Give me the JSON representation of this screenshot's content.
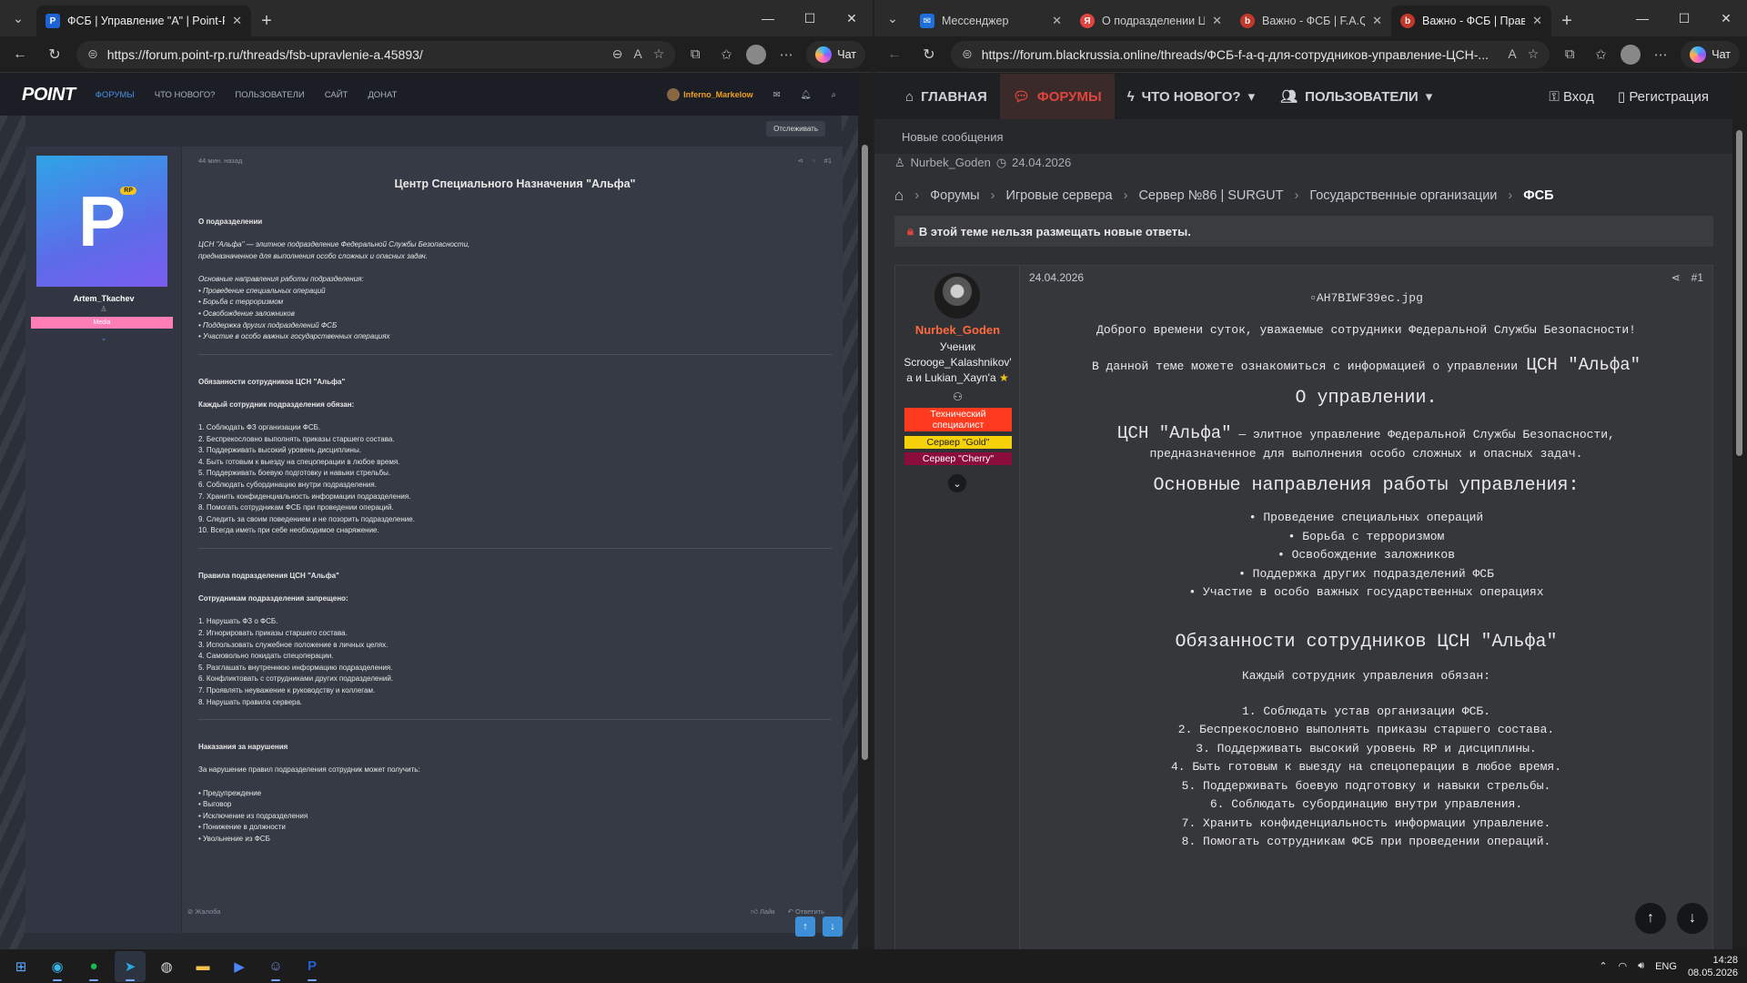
{
  "left": {
    "tab": {
      "label": "ФСБ | Управление \"А\" | Point-Rp"
    },
    "url": "https://forum.point-rp.ru/threads/fsb-upravlenie-a.45893/",
    "chat_label": "Чат",
    "nav": {
      "logo": "POINT",
      "items": [
        "ФОРУМЫ",
        "ЧТО НОВОГО?",
        "ПОЛЬЗОВАТЕЛИ",
        "САЙТ",
        "ДОНАТ"
      ],
      "username": "Inferno_Markelow"
    },
    "follow_label": "Отслеживать",
    "post": {
      "time": "44 мин. назад",
      "num": "#1",
      "author": "Artem_Tkachev",
      "avatar_letter": "P",
      "avatar_badge": "RP",
      "author_group": "Media",
      "title": "Центр Специального Назначения \"Альфа\"",
      "about_h": "О подразделении",
      "about_l1": "ЦСН \"Альфа\" — элитное подразделение Федеральной Службы Безопасности,",
      "about_l2": "предназначенное для выполнения особо сложных и опасных задач.",
      "dirs_h": "Основные направления работы подразделения:",
      "dirs": [
        "• Проведение специальных операций",
        "• Борьба с терроризмом",
        "• Освобождение заложников",
        "• Поддержка других подразделений ФСБ",
        "• Участие в особо важных государственных операциях"
      ],
      "duties_h": "Обязанности сотрудников ЦСН \"Альфа\"",
      "duties_sub": "Каждый сотрудник подразделения обязан:",
      "duties": [
        "1. Соблюдать ФЗ организации ФСБ.",
        "2. Беспрекословно выполнять приказы старшего состава.",
        "3. Поддерживать высокий уровень дисциплины.",
        "4. Быть готовым к выезду на спецоперации в любое время.",
        "5. Поддерживать боевую подготовку и навыки стрельбы.",
        "6. Соблюдать субординацию внутри подразделения.",
        "7. Хранить конфиденциальность информации подразделения.",
        "8. Помогать сотрудникам ФСБ при проведении операций.",
        "9. Следить за своим поведением и не позорить подразделение.",
        "10. Всегда иметь при себе необходимое снаряжение."
      ],
      "rules_h": "Правила подразделения ЦСН \"Альфа\"",
      "rules_sub": "Сотрудникам подразделения запрещено:",
      "rules": [
        "1. Нарушать ФЗ о ФСБ.",
        "2. Игнорировать приказы старшего состава.",
        "3. Использовать служебное положение в личных целях.",
        "4. Самовольно покидать спецоперации.",
        "5. Разглашать внутреннюю информацию подразделения.",
        "6. Конфликтовать с сотрудниками других подразделений.",
        "7. Проявлять неуважение к руководству и коллегам.",
        "8. Нарушать правила сервера."
      ],
      "pun_h": "Наказания за нарушения",
      "pun_sub": "За нарушение правил подразделения сотрудник может получить:",
      "pun": [
        "• Предупреждение",
        "• Выговор",
        "• Исключение из подразделения",
        "• Понижение в должности",
        "• Увольнение из ФСБ"
      ],
      "report": "Жалоба",
      "like": "Лайк",
      "reply": "Ответить"
    }
  },
  "right": {
    "tabs": [
      {
        "label": "Мессенджер",
        "color": "#1e6fd9",
        "icon": "chat"
      },
      {
        "label": "О подразделении ЦС",
        "color": "#e0443e",
        "icon": "Я"
      },
      {
        "label": "Важно - ФСБ | F.A.Q д",
        "color": "#c0392b",
        "icon": "b"
      },
      {
        "label": "Важно - ФСБ | Прави",
        "color": "#c0392b",
        "icon": "b"
      }
    ],
    "url": "https://forum.blackrussia.online/threads/ФСБ-f-a-q-для-сотрудников-управление-ЦСН-...",
    "chat_label": "Чат",
    "nav": {
      "home": "ГЛАВНАЯ",
      "forums": "ФОРУМЫ",
      "whats_new": "ЧТО НОВОГО?",
      "users": "ПОЛЬЗОВАТЕЛИ",
      "login": "Вход",
      "register": "Регистрация"
    },
    "subnav": "Новые сообщения",
    "meta_author": "Nurbek_Goden",
    "meta_date": "24.04.2026",
    "breadcrumbs": [
      "Форумы",
      "Игровые сервера",
      "Сервер №86 | SURGUT",
      "Государственные организации",
      "ФСБ"
    ],
    "lock_notice": "В этой теме нельзя размещать новые ответы.",
    "post": {
      "author": "Nurbek_Goden",
      "rank_l1": "Ученик",
      "rank_l2": "Scrooge_Kalashnikov'",
      "rank_l3": "a и Lukian_Xayn'a",
      "badges": [
        {
          "label": "Технический специалист",
          "bg": "#ff3b1f",
          "color": "#ffffff"
        },
        {
          "label": "Сервер \"Gold\"",
          "bg": "#f5d10a",
          "color": "#222222"
        },
        {
          "label": "Сервер \"Cherry\"",
          "bg": "#8b0d3a",
          "color": "#ffffff"
        }
      ],
      "date": "24.04.2026",
      "num": "#1",
      "image_alt": "AH7BIWF39ec.jpg",
      "greet": "Доброго времени суток, уважаемые сотрудники Федеральной Службы Безопасности!",
      "intro_a": "В данной теме можете ознакомиться с информацией о управлении",
      "intro_b": "ЦСН \"Альфа\"",
      "about_h": "О управлении.",
      "about_a": "ЦСН \"Альфа\"",
      "about_b": " — элитное управление Федеральной Службы Безопасности,",
      "about_c": "предназначенное для выполнения особо сложных и опасных задач.",
      "dirs_h": "Основные направления работы управления:",
      "dirs": [
        "• Проведение специальных операций",
        "• Борьба с терроризмом",
        "• Освобождение заложников",
        "• Поддержка других подразделений ФСБ",
        "• Участие в особо важных государственных операциях"
      ],
      "duties_h": "Обязанности сотрудников ЦСН \"Альфа\"",
      "duties_sub": "Каждый сотрудник управления обязан:",
      "duties": [
        "1. Соблюдать устав организации ФСБ.",
        "2. Беспрекословно выполнять приказы старшего состава.",
        "3. Поддерживать высокий уровень RP и дисциплины.",
        "4. Быть готовым к выезду на спецоперации в любое время.",
        "5. Поддерживать боевую подготовку и навыки стрельбы.",
        "6. Соблюдать субординацию внутри управления.",
        "7. Хранить конфиденциальность информации управление.",
        "8. Помогать сотрудникам ФСБ при проведении операций."
      ]
    }
  },
  "taskbar": {
    "lang": "ENG",
    "time": "14:28",
    "date": "08.05.2026"
  }
}
